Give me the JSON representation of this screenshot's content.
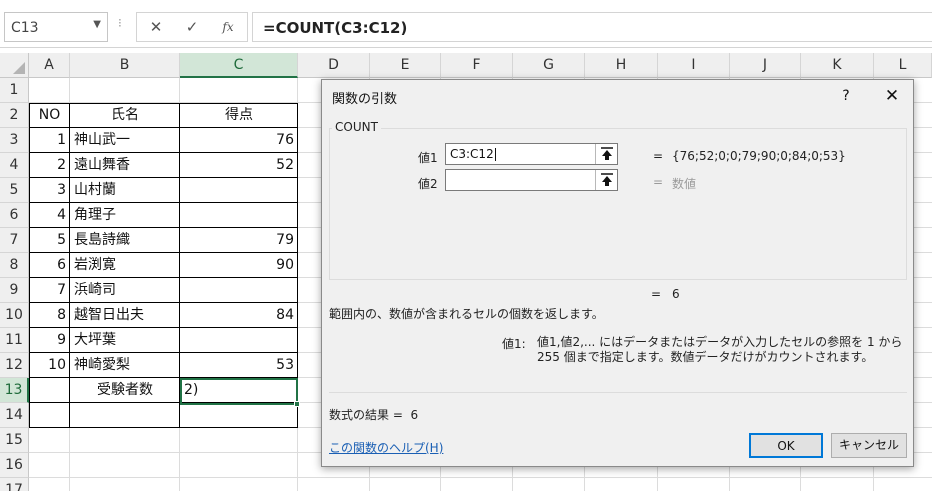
{
  "formula_bar": {
    "name_box": "C13",
    "dots": "⁝",
    "cancel": "✕",
    "enter": "✓",
    "insert_function": "fx",
    "formula": "=COUNT(C3:C12)"
  },
  "columns": [
    "A",
    "B",
    "C",
    "D",
    "E",
    "F",
    "G",
    "H",
    "I",
    "J",
    "K",
    "L"
  ],
  "active_column": "C",
  "active_row": "13",
  "rows": [
    {
      "num": "1",
      "a": "",
      "b": "",
      "c": ""
    },
    {
      "num": "2",
      "a": "NO",
      "b": "氏名",
      "c": "得点"
    },
    {
      "num": "3",
      "a": "1",
      "b": "神山武一",
      "c": "76"
    },
    {
      "num": "4",
      "a": "2",
      "b": "遠山舞香",
      "c": "52"
    },
    {
      "num": "5",
      "a": "3",
      "b": "山村蘭",
      "c": ""
    },
    {
      "num": "6",
      "a": "4",
      "b": "角理子",
      "c": ""
    },
    {
      "num": "7",
      "a": "5",
      "b": "長島詩織",
      "c": "79"
    },
    {
      "num": "8",
      "a": "6",
      "b": "岩渕寛",
      "c": "90"
    },
    {
      "num": "9",
      "a": "7",
      "b": "浜崎司",
      "c": ""
    },
    {
      "num": "10",
      "a": "8",
      "b": "越智日出夫",
      "c": "84"
    },
    {
      "num": "11",
      "a": "9",
      "b": "大坪葉",
      "c": ""
    },
    {
      "num": "12",
      "a": "10",
      "b": "神崎愛梨",
      "c": "53"
    },
    {
      "num": "13",
      "a": "",
      "b": "受験者数",
      "c": "2)"
    },
    {
      "num": "14",
      "a": "",
      "b": "",
      "c": ""
    },
    {
      "num": "15",
      "a": "",
      "b": "",
      "c": ""
    },
    {
      "num": "16",
      "a": "",
      "b": "",
      "c": ""
    },
    {
      "num": "17",
      "a": "",
      "b": "",
      "c": ""
    }
  ],
  "dialog": {
    "title": "関数の引数",
    "help": "?",
    "close": "✕",
    "function_name": "COUNT",
    "args": [
      {
        "label": "値1",
        "value": "C3:C12",
        "result": "{76;52;0;0;79;90;0;84;0;53}"
      },
      {
        "label": "値2",
        "value": "",
        "result": "数値"
      }
    ],
    "eq": "=",
    "total_result": "6",
    "description": "範囲内の、数値が含まれるセルの個数を返します。",
    "arg_desc_name": "値1:",
    "arg_desc_text": "値1,値2,... にはデータまたはデータが入力したセルの参照を 1 から 255 個まで指定します。数値データだけがカウントされます。",
    "formula_result_label": "数式の結果 =",
    "formula_result_value": "6",
    "help_link": "この関数のヘルプ(H)",
    "ok": "OK",
    "cancel": "キャンセル"
  }
}
